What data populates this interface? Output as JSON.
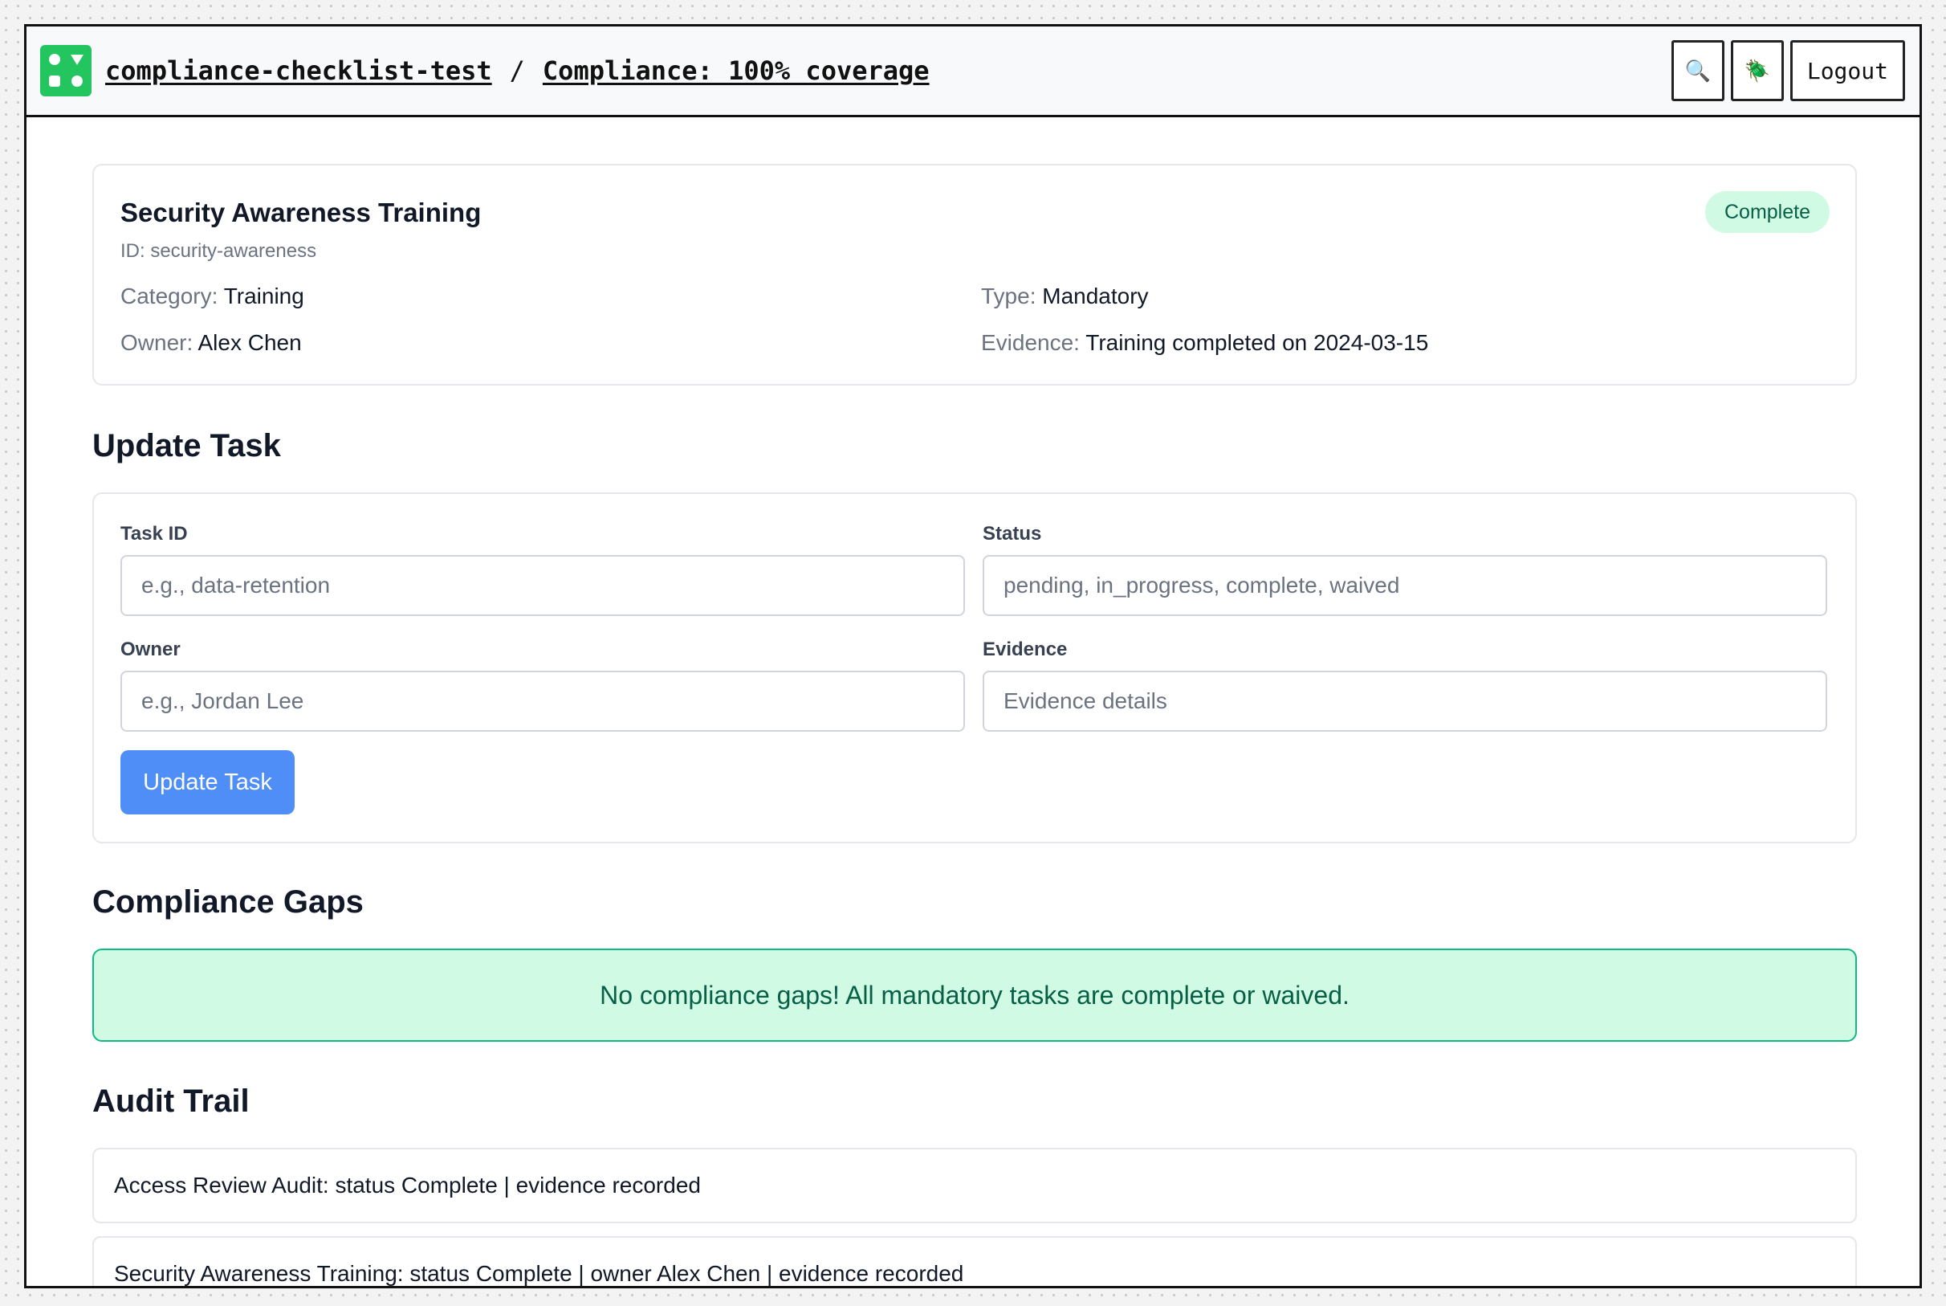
{
  "header": {
    "project": "compliance-checklist-test",
    "separator": "/",
    "page": "Compliance: 100% coverage",
    "search_icon": "🔍",
    "bug_icon": "🪲",
    "logout_label": "Logout"
  },
  "task": {
    "title": "Security Awareness Training",
    "id_text": "ID: security-awareness",
    "status_badge": "Complete",
    "category_key": "Category:",
    "category_value": "Training",
    "type_key": "Type:",
    "type_value": "Mandatory",
    "owner_key": "Owner:",
    "owner_value": "Alex Chen",
    "evidence_key": "Evidence:",
    "evidence_value": "Training completed on 2024-03-15"
  },
  "update_form": {
    "section_title": "Update Task",
    "task_id_label": "Task ID",
    "task_id_placeholder": "e.g., data-retention",
    "status_label": "Status",
    "status_placeholder": "pending, in_progress, complete, waived",
    "owner_label": "Owner",
    "owner_placeholder": "e.g., Jordan Lee",
    "evidence_label": "Evidence",
    "evidence_placeholder": "Evidence details",
    "submit_label": "Update Task"
  },
  "gaps": {
    "section_title": "Compliance Gaps",
    "message": "No compliance gaps! All mandatory tasks are complete or waived."
  },
  "audit": {
    "section_title": "Audit Trail",
    "entries": [
      "Access Review Audit: status Complete | evidence recorded",
      "Security Awareness Training: status Complete | owner Alex Chen | evidence recorded"
    ]
  },
  "colors": {
    "accent_green": "#22c55e",
    "primary_blue": "#4f8ef7",
    "success_bg": "#d1fae5",
    "success_text": "#065f46"
  }
}
